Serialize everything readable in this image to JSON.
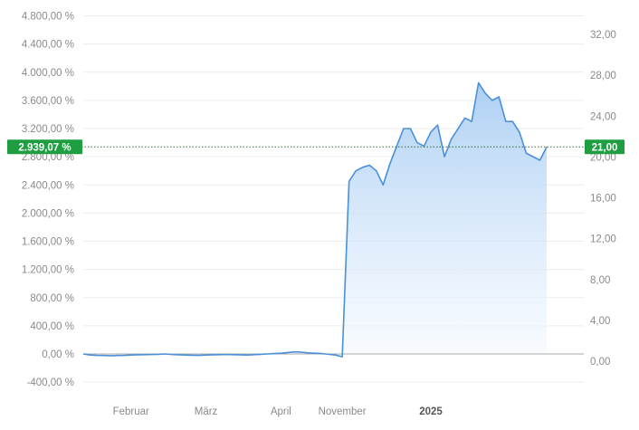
{
  "chart_data": {
    "type": "area",
    "left_axis": {
      "ticks": [
        -400,
        0,
        400,
        800,
        1200,
        1600,
        2000,
        2400,
        2800,
        3200,
        3600,
        4000,
        4400,
        4800
      ],
      "tick_labels": [
        "-400,00 %",
        "0,00 %",
        "400,00 %",
        "800,00 %",
        "1.200,00 %",
        "1.600,00 %",
        "2.000,00 %",
        "2.400,00 %",
        "2.800,00 %",
        "3.200,00 %",
        "3.600,00 %",
        "4.000,00 %",
        "4.400,00 %",
        "4.800,00 %"
      ],
      "ylim": [
        -400,
        4800
      ]
    },
    "right_axis": {
      "ticks": [
        0,
        4,
        8,
        12,
        16,
        20,
        24,
        28,
        32
      ],
      "tick_labels": [
        "0,00",
        "4,00",
        "8,00",
        "12,00",
        "16,00",
        "20,00",
        "24,00",
        "28,00",
        "32,00"
      ],
      "ylim": [
        0,
        32
      ]
    },
    "x_labels": [
      {
        "label": "Februar",
        "index": 7,
        "bold": false
      },
      {
        "label": "März",
        "index": 18,
        "bold": false
      },
      {
        "label": "April",
        "index": 29,
        "bold": false
      },
      {
        "label": "November",
        "index": 38,
        "bold": false
      },
      {
        "label": "2025",
        "index": 51,
        "bold": true
      }
    ],
    "series": [
      {
        "values": [
          0,
          -15,
          -20,
          -22,
          -25,
          -22,
          -20,
          -15,
          -12,
          -10,
          -8,
          -5,
          0,
          -8,
          -12,
          -15,
          -18,
          -20,
          -15,
          -12,
          -10,
          -8,
          -10,
          -12,
          -15,
          -10,
          -5,
          0,
          5,
          10,
          20,
          30,
          25,
          15,
          10,
          5,
          -5,
          -15,
          -40,
          2450,
          2600,
          2650,
          2680,
          2600,
          2400,
          2700,
          2950,
          3200,
          3200,
          3000,
          2950,
          3150,
          3250,
          2800,
          3050,
          3200,
          3350,
          3300,
          3850,
          3700,
          3600,
          3650,
          3300,
          3300,
          3150,
          2850,
          2800,
          2750,
          2939.07
        ]
      }
    ],
    "current_value_left": "2.939,07 %",
    "current_value_right": "21,00",
    "current_value_percent": 2939.07,
    "colors": {
      "line": "#4a90d9",
      "fill_top": "#a9cdf3",
      "fill_bottom": "#f4f9ff",
      "badge": "#1e9e40",
      "grid": "#ececec",
      "zero_line": "#aaaaaa"
    },
    "grid": true
  }
}
